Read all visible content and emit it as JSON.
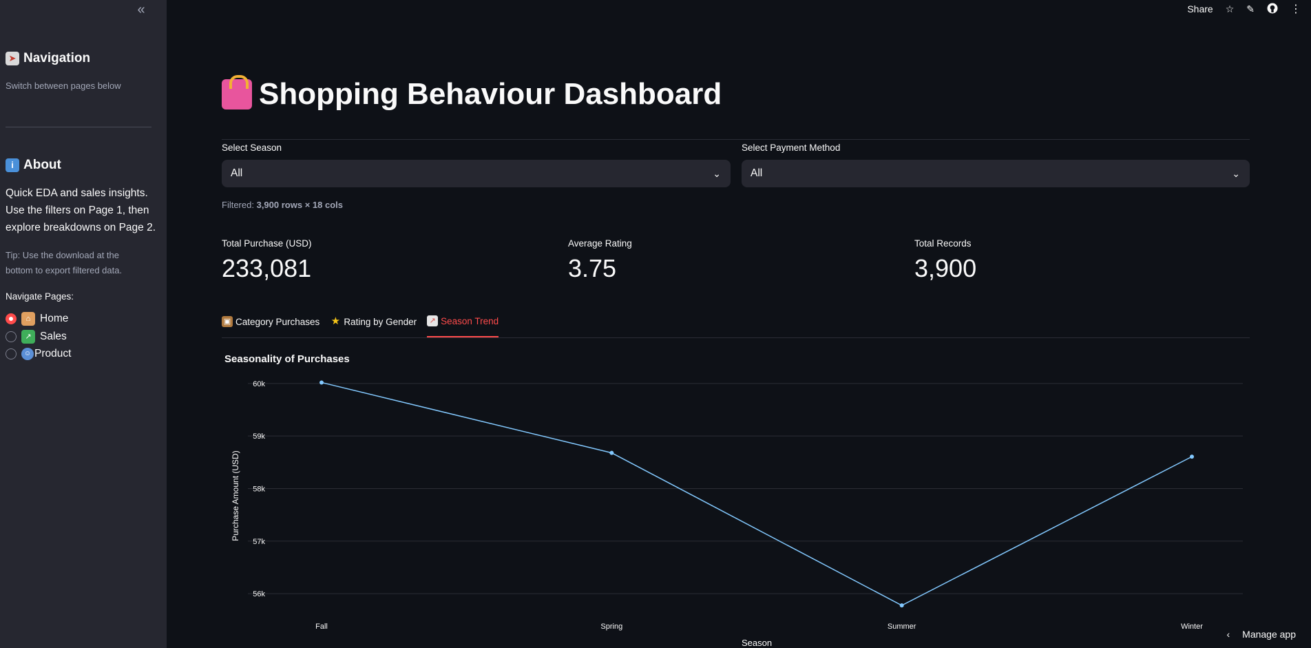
{
  "sidebar": {
    "navigation_title": "Navigation",
    "navigation_subtitle": "Switch between pages below",
    "about_title": "About",
    "about_text": "Quick EDA and sales insights. Use the filters on Page 1, then explore breakdowns on Page 2.",
    "tip": "Tip: Use the download at the bottom to export filtered data.",
    "navigate_label": "Navigate Pages:",
    "pages": [
      {
        "label": "Home",
        "icon": "house-icon",
        "selected": true
      },
      {
        "label": "Sales",
        "icon": "chart-up-icon",
        "selected": false
      },
      {
        "label": "Product",
        "icon": "face-icon",
        "selected": false
      }
    ]
  },
  "toolbar": {
    "share_label": "Share"
  },
  "main": {
    "title": "Shopping Behaviour Dashboard",
    "filters": {
      "season_label": "Select Season",
      "season_value": "All",
      "payment_label": "Select Payment Method",
      "payment_value": "All"
    },
    "filtered_prefix": "Filtered:",
    "filtered_value": "3,900 rows × 18 cols",
    "metrics": [
      {
        "label": "Total Purchase (USD)",
        "value": "233,081"
      },
      {
        "label": "Average Rating",
        "value": "3.75"
      },
      {
        "label": "Total Records",
        "value": "3,900"
      }
    ],
    "tabs": [
      {
        "label": "Category Purchases",
        "icon": "package-icon",
        "active": false
      },
      {
        "label": "Rating by Gender",
        "icon": "star-icon",
        "active": false
      },
      {
        "label": "Season Trend",
        "icon": "chart-up-icon",
        "active": true
      }
    ]
  },
  "chart_data": {
    "type": "line",
    "title": "Seasonality of Purchases",
    "xlabel": "Season",
    "ylabel": "Purchase Amount (USD)",
    "categories": [
      "Fall",
      "Spring",
      "Summer",
      "Winter"
    ],
    "values": [
      60018,
      58679,
      55777,
      58607
    ],
    "ylim": [
      55700,
      60050
    ],
    "yticks": [
      56000,
      57000,
      58000,
      59000,
      60000
    ],
    "ytick_labels": [
      "56k",
      "57k",
      "58k",
      "59k",
      "60k"
    ],
    "grid": true,
    "line_color": "#83c9ff"
  },
  "manage_label": "Manage app"
}
